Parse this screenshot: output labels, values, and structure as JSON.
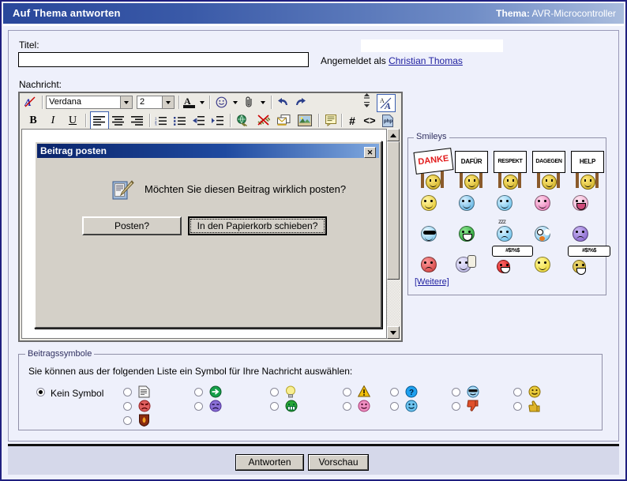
{
  "header": {
    "title": "Auf Thema antworten",
    "topic_label": "Thema:",
    "topic_value": "AVR-Microcontroller"
  },
  "form": {
    "title_label": "Titel:",
    "title_value": "",
    "message_label": "Nachricht:",
    "logged_in_prefix": "Angemeldet als",
    "logged_in_user": "Christian  Thomas"
  },
  "toolbar": {
    "remove_format_icon": "remove-formatting-icon",
    "font_family": "Verdana",
    "font_size": "2",
    "font_color_icon": "font-color-icon",
    "smiley_icon": "smiley-insert-icon",
    "attach_icon": "attachment-icon",
    "undo_icon": "undo-icon",
    "redo_icon": "redo-icon",
    "bold": "B",
    "italic": "I",
    "underline": "U",
    "align_left_icon": "align-left-icon",
    "align_center_icon": "align-center-icon",
    "align_right_icon": "align-right-icon",
    "ordered_list_icon": "ordered-list-icon",
    "unordered_list_icon": "unordered-list-icon",
    "outdent_icon": "outdent-icon",
    "indent_icon": "indent-icon",
    "link_icon": "insert-link-icon",
    "unlink_icon": "remove-link-icon",
    "email_icon": "insert-email-icon",
    "image_icon": "insert-image-icon",
    "quote_icon": "insert-quote-icon",
    "hash": "#",
    "code": "<>",
    "php": "php",
    "size_updown_icon": "increase-decrease-size-icon",
    "wysiwyg_toggle_icon": "wysiwyg-toggle-icon"
  },
  "dialog": {
    "title": "Beitrag posten",
    "close_label": "✕",
    "icon": "post-document-icon",
    "message": "Möchten Sie diesen Beitrag wirklich posten?",
    "button_confirm": "Posten?",
    "button_trash": "In den Papierkorb schieben?"
  },
  "smileys": {
    "legend": "Smileys",
    "more_link": "[Weitere]",
    "signs": [
      {
        "text": "DANKE",
        "style": "handwritten-red"
      },
      {
        "text": "DAFÜR",
        "style": "plain"
      },
      {
        "text": "RESPEKT",
        "style": "plain"
      },
      {
        "text": "DAGEGEN",
        "style": "plain"
      },
      {
        "text": "HELP",
        "style": "plain"
      }
    ],
    "rows": [
      [
        {
          "name": "smile",
          "color": "#f2d43c"
        },
        {
          "name": "wink",
          "color": "#7cc6ef"
        },
        {
          "name": "big-grin",
          "color": "#8fd3f4"
        },
        {
          "name": "blush",
          "color": "#f09dc9"
        },
        {
          "name": "laugh",
          "color": "#f3b9d3"
        }
      ],
      [
        {
          "name": "cool-sunglasses",
          "color": "#9fd4f2"
        },
        {
          "name": "grin-teeth",
          "color": "#3fae4a"
        },
        {
          "name": "sleepy-zzz",
          "color": "#8fd3f4"
        },
        {
          "name": "shocked",
          "color": "#9fd4f2"
        },
        {
          "name": "confused",
          "color": "#9a7ddb"
        }
      ],
      [
        {
          "name": "angry-red",
          "color": "#e05a5a"
        },
        {
          "name": "thumbs-up-smiley",
          "color": "#c9cbe8"
        },
        {
          "name": "swearing-red",
          "color": "#e02020"
        },
        {
          "name": "yellow-smile",
          "color": "#f5e13c"
        },
        {
          "name": "swearing-yellow",
          "color": "#d8c13a"
        }
      ]
    ],
    "curse_bubble": "#$!%$"
  },
  "symbols": {
    "legend": "Beitragssymbole",
    "description": "Sie können aus der folgenden Liste ein Symbol für Ihre Nachricht auswählen:",
    "none_label": "Kein Symbol",
    "none_selected": true,
    "columns": [
      [
        {
          "name": "document-icon",
          "color": "#dcdcdc",
          "selected": false
        },
        {
          "name": "angry-red-face-icon",
          "color": "#e06060",
          "selected": false
        },
        {
          "name": "flame-shield-icon",
          "color": "#a03010",
          "selected": false
        }
      ],
      [
        {
          "name": "green-arrow-icon",
          "color": "#16a04a",
          "selected": false
        },
        {
          "name": "purple-annoyed-icon",
          "color": "#8a6fd6",
          "selected": false
        }
      ],
      [
        {
          "name": "lightbulb-icon",
          "color": "#f6e96a",
          "selected": false
        },
        {
          "name": "green-grin-icon",
          "color": "#27a637",
          "selected": false
        }
      ],
      [
        {
          "name": "warning-triangle-icon",
          "color": "#f2c00c",
          "selected": false
        },
        {
          "name": "pink-smile-icon",
          "color": "#ef8fc2",
          "selected": false
        }
      ],
      [
        {
          "name": "question-blue-icon",
          "color": "#1ea0ef",
          "selected": false
        },
        {
          "name": "blue-smile-icon",
          "color": "#6ec4f0",
          "selected": false
        }
      ],
      [
        {
          "name": "cool-sunglasses-icon",
          "color": "#a9d8f3",
          "selected": false
        },
        {
          "name": "thumbs-down-icon",
          "color": "#e0502a",
          "selected": false
        }
      ],
      [
        {
          "name": "yellow-smile-icon",
          "color": "#e8c93a",
          "selected": false
        },
        {
          "name": "thumbs-up-icon",
          "color": "#e0b52a",
          "selected": false
        }
      ]
    ]
  },
  "footer": {
    "submit_label": "Antworten",
    "preview_label": "Vorschau"
  }
}
